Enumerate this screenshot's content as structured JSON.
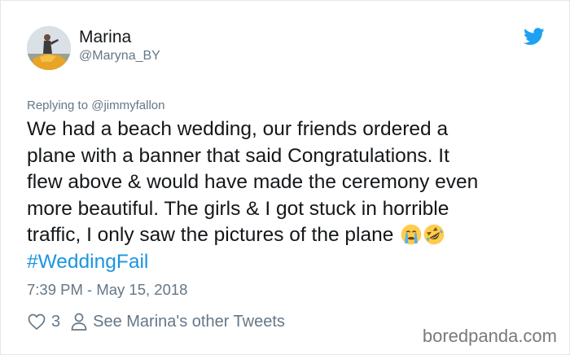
{
  "tweet": {
    "author_name": "Marina",
    "author_handle": "@Maryna_BY",
    "replying_prefix": "Replying to ",
    "replying_to": "@jimmyfallon",
    "text_lines": [
      "We had a beach wedding, our friends ordered a",
      "plane with a banner that said Congratulations. It",
      "flew above & would have made the ceremony even",
      "more beautiful. The girls & I got stuck in horrible",
      "traffic, I only saw the pictures of the plane"
    ],
    "emojis": [
      "crying-face-emoji",
      "rofl-emoji"
    ],
    "hashtag": "#WeddingFail",
    "timestamp": "7:39 PM - May 15, 2018",
    "like_count": "3",
    "other_tweets_label": "See Marina's other Tweets"
  },
  "colors": {
    "link": "#1b95e0",
    "secondary_text": "#657786",
    "primary_text": "#14171a",
    "twitter_blue": "#1da1f2",
    "border": "#e1e8ed"
  },
  "watermark": "boredpanda.com"
}
